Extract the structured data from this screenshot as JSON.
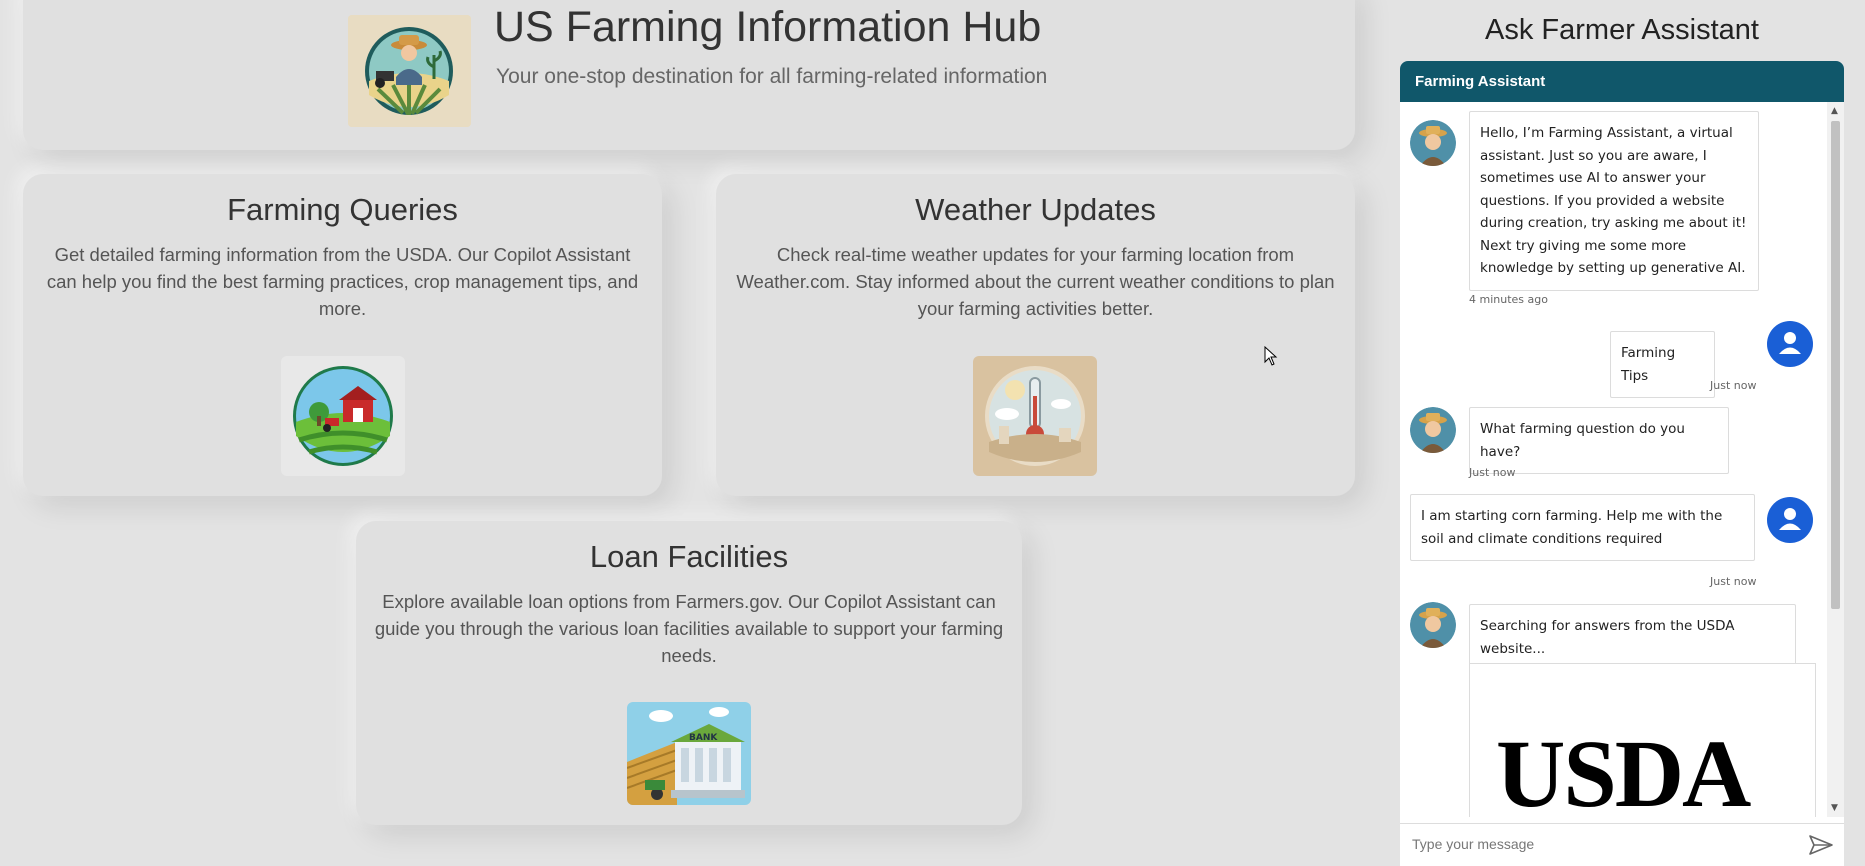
{
  "header": {
    "title": "US Farming Information Hub",
    "subtitle": "Your one-stop destination for all farming-related information",
    "logo_icon": "farmer-logo-icon"
  },
  "cards": {
    "queries": {
      "title": "Farming Queries",
      "description": "Get detailed farming information from the USDA. Our Copilot Assistant can help you find the best farming practices, crop management tips, and more.",
      "image_icon": "farm-barn-icon"
    },
    "weather": {
      "title": "Weather Updates",
      "description": "Check real-time weather updates for your farming location from Weather.com. Stay informed about the current weather conditions to plan your farming activities better.",
      "image_icon": "thermometer-weather-icon"
    },
    "loans": {
      "title": "Loan Facilities",
      "description": "Explore available loan options from Farmers.gov. Our Copilot Assistant can guide you through the various loan facilities available to support your farming needs.",
      "image_icon": "bank-building-icon"
    }
  },
  "assistant": {
    "heading": "Ask Farmer Assistant",
    "header_title": "Farming Assistant",
    "messages": [
      {
        "from": "bot",
        "text": "Hello, I’m Farming Assistant, a virtual assistant. Just so you are aware, I sometimes use AI to answer your questions. If you provided a website during creation, try asking me about it! Next try giving me some more knowledge by setting up generative AI.",
        "time": "4 minutes ago"
      },
      {
        "from": "user",
        "text": "Farming Tips",
        "time": "Just now"
      },
      {
        "from": "bot",
        "text": "What farming question do you have?",
        "time": "Just now"
      },
      {
        "from": "user",
        "text": "I am starting corn farming. Help me with the soil and climate conditions required",
        "time": "Just now"
      },
      {
        "from": "bot",
        "text": "Searching for answers from the USDA website...",
        "time": ""
      }
    ],
    "usda_logo_text": "USDA",
    "input_placeholder": "Type your message"
  },
  "colors": {
    "background": "#e3e3e3",
    "card": "#e0e0e0",
    "chat_header": "#10576a",
    "user_avatar": "#1a5fd6"
  }
}
